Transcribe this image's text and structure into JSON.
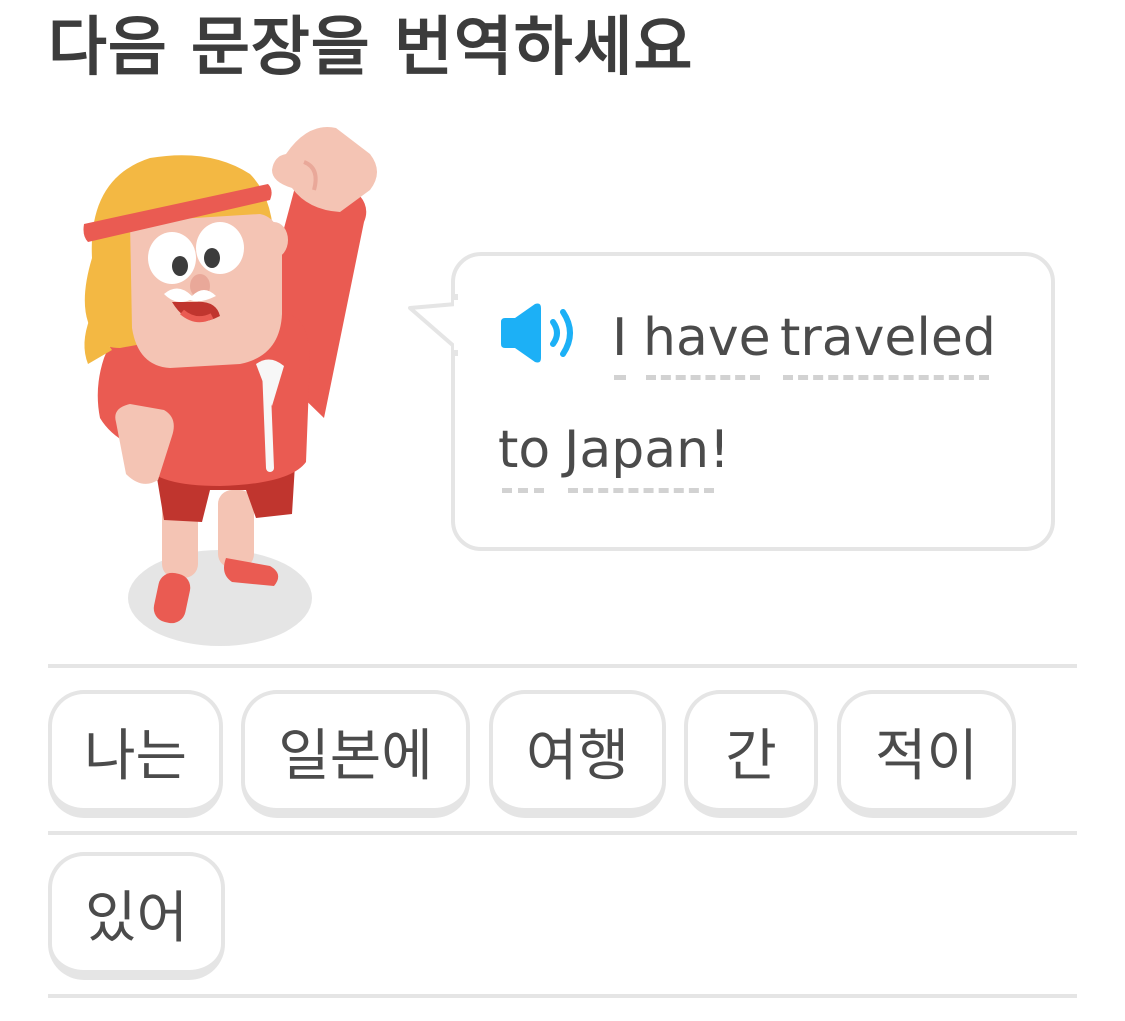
{
  "header": {
    "title": "다음 문장을 번역하세요"
  },
  "prompt": {
    "speaker_icon": "speaker-icon",
    "words": [
      "I",
      "have",
      "traveled",
      "to",
      "Japan!"
    ]
  },
  "word_bank": {
    "chips": [
      "나는",
      "일본에",
      "여행",
      "간",
      "적이",
      "있어"
    ]
  },
  "colors": {
    "accent_blue": "#1cb0f6",
    "character_red": "#ea5b52",
    "hair_yellow": "#f3b843",
    "border_gray": "#e5e5e5",
    "text": "#4b4b4b"
  }
}
